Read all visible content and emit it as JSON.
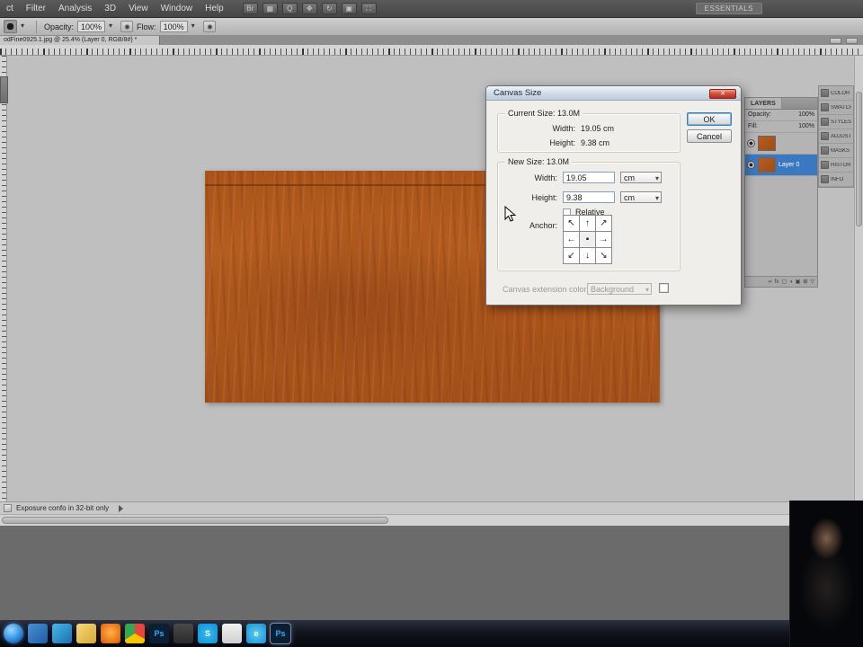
{
  "app": {
    "workspace_button": "ESSENTIALS"
  },
  "menu_bar": {
    "items": [
      "ct",
      "Filter",
      "Analysis",
      "3D",
      "View",
      "Window",
      "Help"
    ],
    "appbar_icons": [
      {
        "name": "bridge-icon",
        "glyph": "Br"
      },
      {
        "name": "view-extras-icon",
        "glyph": "▦"
      },
      {
        "name": "zoom-tool-icon",
        "glyph": "Q"
      },
      {
        "name": "hand-tool-icon",
        "glyph": "✥"
      },
      {
        "name": "rotate-view-icon",
        "glyph": "↻"
      },
      {
        "name": "arrange-documents-icon",
        "glyph": "▣"
      },
      {
        "name": "screen-mode-icon",
        "glyph": "⛶"
      }
    ]
  },
  "options_bar": {
    "opacity_label": "Opacity:",
    "opacity_value": "100%",
    "flow_label": "Flow:",
    "flow_value": "100%"
  },
  "document_tab": {
    "title": "odFine0925.1.jpg @ 25.4% (Layer 0, RGB/8#) *"
  },
  "canvas_dialog": {
    "title": "Canvas Size",
    "current": {
      "legend": "Current Size: 13.0M",
      "width_label": "Width:",
      "width_value": "19.05 cm",
      "height_label": "Height:",
      "height_value": "9.38 cm"
    },
    "new": {
      "legend": "New Size: 13.0M",
      "width_label": "Width:",
      "width_value": "19.05",
      "width_unit": "cm",
      "height_label": "Height:",
      "height_value": "9.38",
      "height_unit": "cm",
      "relative_label": "Relative",
      "anchor_label": "Anchor:",
      "anchor_cells": [
        "↖",
        "↑",
        "↗",
        "←",
        "▪",
        "→",
        "↙",
        "↓",
        "↘"
      ]
    },
    "extension_label": "Canvas extension color:",
    "extension_value": "Background",
    "buttons": {
      "ok": "OK",
      "cancel": "Cancel"
    }
  },
  "layers_panel": {
    "tab_label": "LAYERS",
    "opacity_label": "Opacity:",
    "opacity_value": "100%",
    "fill_label": "Fill:",
    "fill_value": "100%",
    "rows": [
      {
        "name": "",
        "selected": false
      },
      {
        "name": "Layer 0",
        "selected": true
      }
    ],
    "footer_icons": [
      {
        "name": "link-layers-icon",
        "glyph": "∞"
      },
      {
        "name": "layer-effects-icon",
        "glyph": "fx"
      },
      {
        "name": "layer-mask-icon",
        "glyph": "▢"
      },
      {
        "name": "adjustment-layer-icon",
        "glyph": "◑"
      },
      {
        "name": "layer-group-icon",
        "glyph": "▣"
      },
      {
        "name": "new-layer-icon",
        "glyph": "⊞"
      },
      {
        "name": "delete-layer-icon",
        "glyph": "▽"
      }
    ]
  },
  "dock_panels": [
    {
      "name": "panel-color",
      "label": "COLOR"
    },
    {
      "name": "panel-swatches",
      "label": "SWATCHES"
    },
    {
      "name": "panel-styles",
      "label": "STYLES"
    },
    {
      "name": "panel-adjustments",
      "label": "ADJUSTMENTS"
    },
    {
      "name": "panel-masks",
      "label": "MASKS"
    },
    {
      "name": "panel-history",
      "label": "HISTORY"
    },
    {
      "name": "panel-info",
      "label": "INFO"
    }
  ],
  "status_bar": {
    "info": "Exposure confo in 32-bit only"
  },
  "taskbar": {
    "items": [
      {
        "name": "start-orb",
        "shape": "orb",
        "color": "radial-gradient(circle at 38% 32%, #9fd8ff, #2e8ede 55%, #0b4a9e 90%)",
        "glyph": ""
      },
      {
        "name": "media-app",
        "color": "linear-gradient(135deg,#4a8fd4,#1d5da8)",
        "glyph": ""
      },
      {
        "name": "messenger-app",
        "color": "linear-gradient(135deg,#49b8e8,#1a6fae)",
        "glyph": ""
      },
      {
        "name": "windows-explorer",
        "color": "linear-gradient(135deg,#f5d97a,#d9a832)",
        "glyph": ""
      },
      {
        "name": "firefox",
        "color": "radial-gradient(circle at 50% 45%, #ffb347, #e8731a 70%, #c2540e)",
        "glyph": ""
      },
      {
        "name": "chrome",
        "color": "conic-gradient(#e8453c 0 33%, #f7c600 33% 66%, #36a852 66% 100%)",
        "glyph": ""
      },
      {
        "name": "photoshop",
        "color": "#0a1f33",
        "glyph": "Ps",
        "glyph_color": "#31a8ff"
      },
      {
        "name": "dark-app",
        "color": "linear-gradient(#4a4a4a,#2a2a2a)",
        "glyph": ""
      },
      {
        "name": "skype",
        "color": "radial-gradient(circle,#35bdf2,#0f8fd0)",
        "glyph": "S"
      },
      {
        "name": "document-app",
        "color": "linear-gradient(#f2f2f2,#cfcfcf)",
        "glyph": ""
      },
      {
        "name": "internet-explorer",
        "color": "radial-gradient(circle,#5ad0f5,#1a8fd0)",
        "glyph": "e"
      },
      {
        "name": "photoshop-active",
        "color": "#0a1f33",
        "glyph": "Ps",
        "glyph_color": "#31a8ff",
        "active": true
      }
    ]
  }
}
